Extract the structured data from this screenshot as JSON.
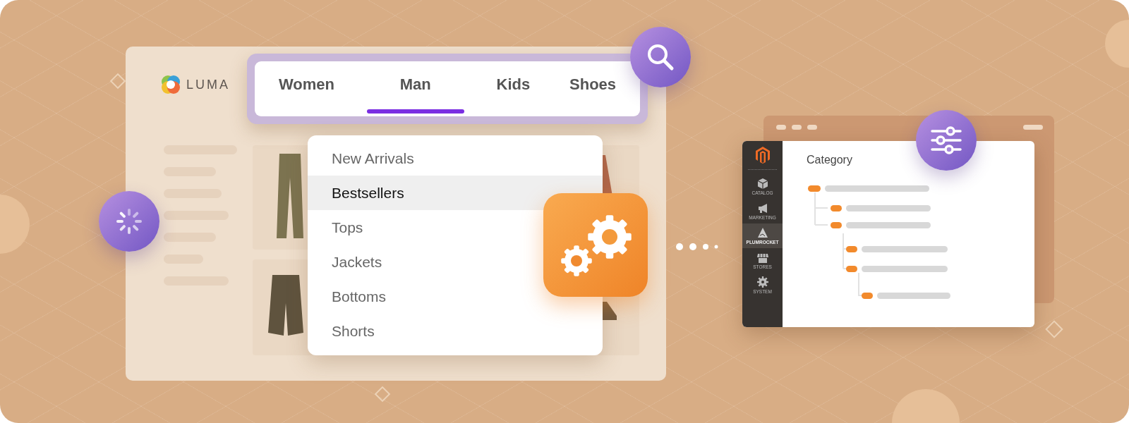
{
  "store": {
    "logo": "LUMA"
  },
  "tabs": [
    {
      "label": "Women",
      "selected": false
    },
    {
      "label": "Man",
      "selected": true
    },
    {
      "label": "Kids",
      "selected": false
    },
    {
      "label": "Shoes",
      "selected": false
    }
  ],
  "menu": [
    {
      "label": "New Arrivals",
      "selected": false
    },
    {
      "label": "Bestsellers",
      "selected": true
    },
    {
      "label": "Tops",
      "selected": false
    },
    {
      "label": "Jackets",
      "selected": false
    },
    {
      "label": "Bottoms",
      "selected": false
    },
    {
      "label": "Shorts",
      "selected": false
    }
  ],
  "admin": {
    "sidebar": [
      {
        "label": "CATALOG",
        "selected": false
      },
      {
        "label": "MARKETING",
        "selected": false
      },
      {
        "label": "PLUMROCKET",
        "selected": true
      },
      {
        "label": "STORES",
        "selected": false
      },
      {
        "label": "SYSTEM",
        "selected": false
      }
    ],
    "heading": "Category"
  }
}
